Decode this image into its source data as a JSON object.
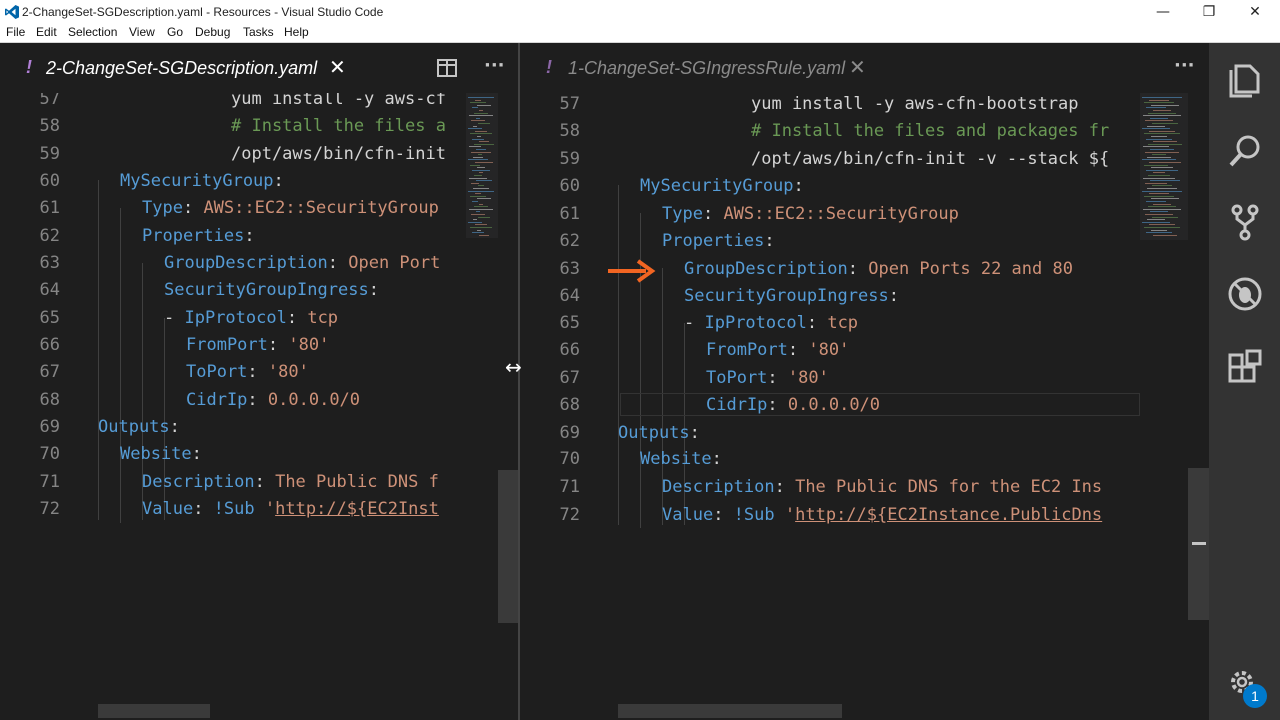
{
  "window": {
    "title": "2-ChangeSet-SGDescription.yaml - Resources - Visual Studio Code",
    "controls": {
      "minimize": "—",
      "maximize": "❐",
      "close": "✕"
    }
  },
  "menu": [
    "File",
    "Edit",
    "Selection",
    "View",
    "Go",
    "Debug",
    "Tasks",
    "Help"
  ],
  "left_tab": {
    "icon": "!",
    "label": "2-ChangeSet-SGDescription.yaml",
    "close": "✕"
  },
  "right_tab": {
    "icon": "!",
    "label": "1-ChangeSet-SGIngressRule.yaml",
    "close": "✕"
  },
  "editor_actions": {
    "split": "split-editor-icon",
    "more": "···"
  },
  "resize_cursor": "↔",
  "left_code": {
    "line_numbers": [
      "57",
      "58",
      "59",
      "60",
      "61",
      "62",
      "63",
      "64",
      "65",
      "66",
      "67",
      "68",
      "69",
      "70",
      "71",
      "72"
    ],
    "l57": "yum install -y aws-cf",
    "l58": "# Install the files a",
    "l59": "/opt/aws/bin/cfn-init",
    "l60": "MySecurityGroup",
    "l61_key": "Type",
    "l61_val": "AWS::EC2::SecurityGroup",
    "l62": "Properties",
    "l63_key": "GroupDescription",
    "l63_val": "Open Port",
    "l64": "SecurityGroupIngress",
    "l65_dash": "- ",
    "l65_key": "IpProtocol",
    "l65_val": "tcp",
    "l66_key": "FromPort",
    "l66_val": "'80'",
    "l67_key": "ToPort",
    "l67_val": "'80'",
    "l68_key": "CidrIp",
    "l68_val": "0.0.0.0/0",
    "l69": "Outputs",
    "l70": "Website",
    "l71_key": "Description",
    "l71_val": "The Public DNS f",
    "l72_key": "Value",
    "l72_tag": "!Sub",
    "l72_q": "'",
    "l72_url": "http://${EC2Inst"
  },
  "right_code": {
    "line_numbers": [
      "57",
      "58",
      "59",
      "60",
      "61",
      "62",
      "63",
      "64",
      "65",
      "66",
      "67",
      "68",
      "69",
      "70",
      "71",
      "72"
    ],
    "l57": "yum install -y aws-cfn-bootstrap",
    "l58": "# Install the files and packages fr",
    "l59": "/opt/aws/bin/cfn-init -v --stack ${",
    "l60": "MySecurityGroup",
    "l61_key": "Type",
    "l61_val": "AWS::EC2::SecurityGroup",
    "l62": "Properties",
    "l63_key": "GroupDescription",
    "l63_val": "Open Ports 22 and 80",
    "l64": "SecurityGroupIngress",
    "l65_dash": "- ",
    "l65_key": "IpProtocol",
    "l65_val": "tcp",
    "l66_key": "FromPort",
    "l66_val": "'80'",
    "l67_key": "ToPort",
    "l67_val": "'80'",
    "l68_key": "CidrIp",
    "l68_val": "0.0.0.0/0",
    "l69": "Outputs",
    "l70": "Website",
    "l71_key": "Description",
    "l71_val": "The Public DNS for the EC2 Ins",
    "l72_key": "Value",
    "l72_tag": "!Sub",
    "l72_q": "'",
    "l72_url": "http://${EC2Instance.PublicDns"
  },
  "activity_bar": {
    "items": [
      "explorer-icon",
      "search-icon",
      "source-control-icon",
      "debug-icon",
      "extensions-icon"
    ],
    "settings": "gear-icon",
    "badge": "1"
  },
  "colors": {
    "key": "#569cd6",
    "string": "#ce9178",
    "comment": "#6a9955",
    "arrow": "#f26522",
    "accent": "#007acc"
  }
}
